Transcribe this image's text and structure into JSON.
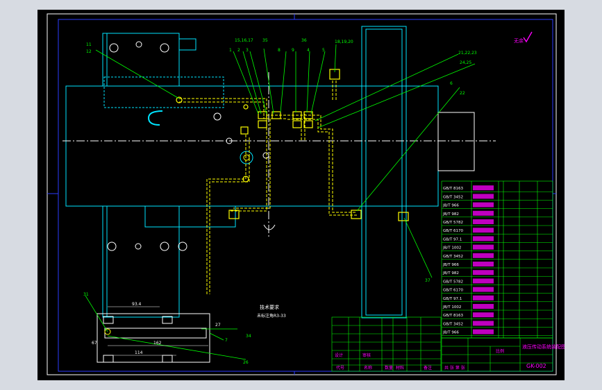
{
  "colors": {
    "canvas_bg": "#000000",
    "app_bg": "#d7dbe2",
    "frame": "#ffffff",
    "border_blue": "#2b3cff",
    "part_outline": "#00e5ff",
    "piping": "#ffff00",
    "leader": "#00ff00",
    "magenta_text": "#ff00ff",
    "center_line": "#ffffff",
    "table_grid": "#00ff00"
  },
  "top_note": {
    "label": "无余",
    "check_icon": "check-mark-icon"
  },
  "part_labels": {
    "a": "15,16,17",
    "b": "35",
    "c": "36",
    "d": "18,19,20",
    "e": "1",
    "f": "2",
    "g": "3",
    "h": "8",
    "i": "9",
    "j": "4",
    "k": "5",
    "l": "21,22,23",
    "m": "24,25",
    "n": "6",
    "o": "37",
    "p": "7",
    "q": "34",
    "r": "26",
    "left_top": "11",
    "left_side": "12",
    "right_group": "22",
    "bottom_left_top": "31"
  },
  "dimensions": {
    "d1": "93.4",
    "d2": "162",
    "d3": "114",
    "d4": "27",
    "d5": "67"
  },
  "tech_notes": {
    "title": "技术要求",
    "line1": "未标注角R3-33"
  },
  "title_block": {
    "drawing_name": "液压传动系统装配图",
    "drawing_number": "GK-002",
    "name_col_header": "名称",
    "code_col_header": "代号",
    "qty_col_header": "数量",
    "material_col_header": "材料",
    "note_col_header": "备注",
    "designer_label": "设计",
    "check_label": "审核",
    "scale_label": "比例",
    "sheet_label": "共 张 第 张"
  },
  "bom_rows": [
    "GB/T 8163",
    "GB/T 3452",
    "JB/T 966",
    "JB/T 982",
    "GB/T 5782",
    "GB/T 6170",
    "GB/T 97.1",
    "JB/T 1002",
    "GB/T 3452",
    "JB/T 966",
    "JB/T 982",
    "GB/T 5782",
    "GB/T 6170",
    "GB/T 97.1",
    "JB/T 1002",
    "GB/T 8163",
    "GB/T 3452",
    "JB/T 966"
  ]
}
